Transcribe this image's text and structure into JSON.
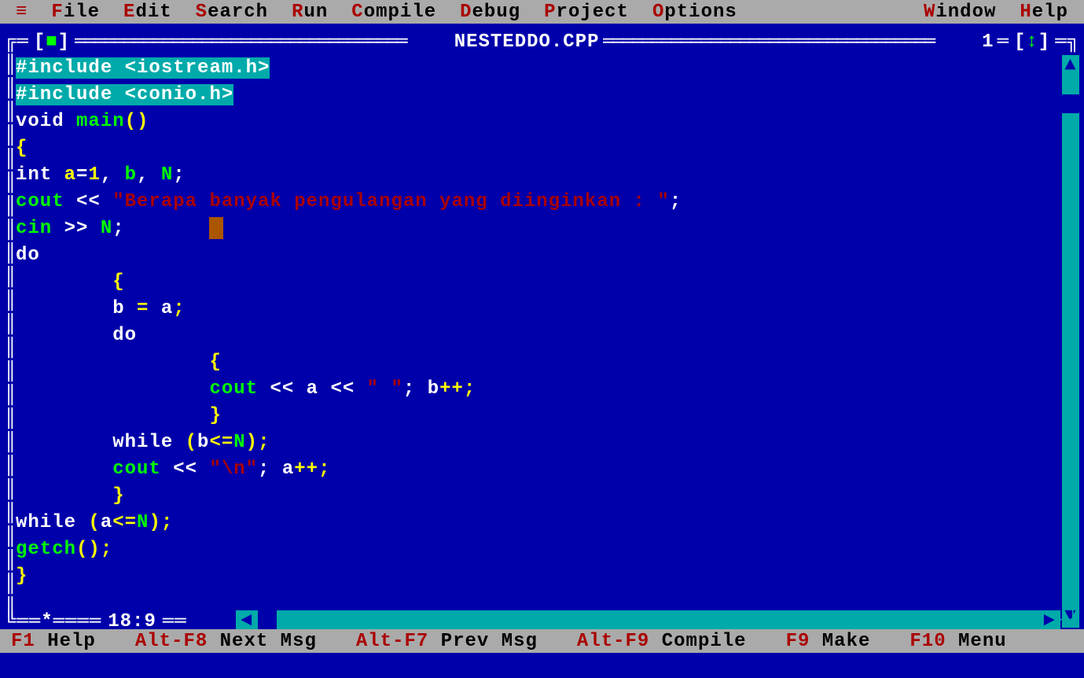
{
  "menu": {
    "items": [
      {
        "hot": "≡",
        "rest": ""
      },
      {
        "hot": "F",
        "rest": "ile"
      },
      {
        "hot": "E",
        "rest": "dit"
      },
      {
        "hot": "S",
        "rest": "earch"
      },
      {
        "hot": "R",
        "rest": "un"
      },
      {
        "hot": "C",
        "rest": "ompile"
      },
      {
        "hot": "D",
        "rest": "ebug"
      },
      {
        "hot": "P",
        "rest": "roject"
      },
      {
        "hot": "O",
        "rest": "ptions"
      },
      {
        "hot": "W",
        "rest": "indow"
      },
      {
        "hot": "H",
        "rest": "elp"
      }
    ]
  },
  "window": {
    "title": "NESTEDDO.CPP",
    "number": "1",
    "cursor_pos": "18:9"
  },
  "code": {
    "lines": [
      [
        {
          "t": "#include <iostream.h>",
          "c": "hl"
        }
      ],
      [
        {
          "t": "#include <conio.h>",
          "c": "hl"
        }
      ],
      [
        {
          "t": "void",
          "c": "kw-white"
        },
        {
          "t": " ",
          "c": ""
        },
        {
          "t": "main",
          "c": "kw-green"
        },
        {
          "t": "()",
          "c": "kw-yellow"
        }
      ],
      [
        {
          "t": "{",
          "c": "kw-yellow"
        }
      ],
      [
        {
          "t": "int",
          "c": "kw-white"
        },
        {
          "t": " ",
          "c": ""
        },
        {
          "t": "a",
          "c": "kw-yellow"
        },
        {
          "t": "=",
          "c": "kw-white"
        },
        {
          "t": "1",
          "c": "kw-yellow"
        },
        {
          "t": ",",
          "c": "kw-white"
        },
        {
          "t": " ",
          "c": ""
        },
        {
          "t": "b",
          "c": "kw-green"
        },
        {
          "t": ",",
          "c": "kw-white"
        },
        {
          "t": " ",
          "c": ""
        },
        {
          "t": "N",
          "c": "kw-green"
        },
        {
          "t": ";",
          "c": "kw-white"
        }
      ],
      [
        {
          "t": "cout",
          "c": "kw-green"
        },
        {
          "t": " << ",
          "c": "kw-white"
        },
        {
          "t": "\"Berapa banyak pengulangan yang diinginkan : \"",
          "c": "kw-red"
        },
        {
          "t": ";",
          "c": "kw-white"
        }
      ],
      [
        {
          "t": "cin",
          "c": "kw-green"
        },
        {
          "t": " >> ",
          "c": "kw-white"
        },
        {
          "t": "N",
          "c": "kw-green"
        },
        {
          "t": ";",
          "c": "kw-white"
        },
        {
          "t": "       ",
          "c": ""
        },
        {
          "t": "",
          "c": "cursor"
        }
      ],
      [
        {
          "t": "do",
          "c": "kw-white"
        }
      ],
      [
        {
          "t": "        {",
          "c": "kw-yellow"
        }
      ],
      [
        {
          "t": "        ",
          "c": ""
        },
        {
          "t": "b",
          "c": "kw-white"
        },
        {
          "t": " = ",
          "c": "kw-yellow"
        },
        {
          "t": "a",
          "c": "kw-white"
        },
        {
          "t": ";",
          "c": "kw-yellow"
        }
      ],
      [
        {
          "t": "        do",
          "c": "kw-white"
        }
      ],
      [
        {
          "t": "                {",
          "c": "kw-yellow"
        }
      ],
      [
        {
          "t": "                ",
          "c": ""
        },
        {
          "t": "cout",
          "c": "kw-green"
        },
        {
          "t": " << ",
          "c": "kw-white"
        },
        {
          "t": "a",
          "c": "kw-white"
        },
        {
          "t": " << ",
          "c": "kw-white"
        },
        {
          "t": "\" \"",
          "c": "kw-red"
        },
        {
          "t": "; ",
          "c": "kw-white"
        },
        {
          "t": "b",
          "c": "kw-white"
        },
        {
          "t": "++;",
          "c": "kw-yellow"
        }
      ],
      [
        {
          "t": "                }",
          "c": "kw-yellow"
        }
      ],
      [
        {
          "t": "        while ",
          "c": "kw-white"
        },
        {
          "t": "(",
          "c": "kw-yellow"
        },
        {
          "t": "b",
          "c": "kw-white"
        },
        {
          "t": "<=",
          "c": "kw-yellow"
        },
        {
          "t": "N",
          "c": "kw-green"
        },
        {
          "t": ");",
          "c": "kw-yellow"
        }
      ],
      [
        {
          "t": "        ",
          "c": ""
        },
        {
          "t": "cout",
          "c": "kw-green"
        },
        {
          "t": " << ",
          "c": "kw-white"
        },
        {
          "t": "\"\\n\"",
          "c": "kw-red"
        },
        {
          "t": "; ",
          "c": "kw-white"
        },
        {
          "t": "a",
          "c": "kw-white"
        },
        {
          "t": "++;",
          "c": "kw-yellow"
        }
      ],
      [
        {
          "t": "        }",
          "c": "kw-yellow"
        }
      ],
      [
        {
          "t": "while ",
          "c": "kw-white"
        },
        {
          "t": "(",
          "c": "kw-yellow"
        },
        {
          "t": "a",
          "c": "kw-white"
        },
        {
          "t": "<=",
          "c": "kw-yellow"
        },
        {
          "t": "N",
          "c": "kw-green"
        },
        {
          "t": ");",
          "c": "kw-yellow"
        }
      ],
      [
        {
          "t": "getch",
          "c": "kw-green"
        },
        {
          "t": "();",
          "c": "kw-yellow"
        }
      ],
      [
        {
          "t": "}",
          "c": "kw-yellow"
        }
      ]
    ]
  },
  "status": {
    "items": [
      {
        "key": "F1",
        "label": " Help"
      },
      {
        "key": "Alt-F8",
        "label": " Next Msg"
      },
      {
        "key": "Alt-F7",
        "label": " Prev Msg"
      },
      {
        "key": "Alt-F9",
        "label": " Compile"
      },
      {
        "key": "F9",
        "label": " Make"
      },
      {
        "key": "F10",
        "label": " Menu"
      }
    ]
  }
}
